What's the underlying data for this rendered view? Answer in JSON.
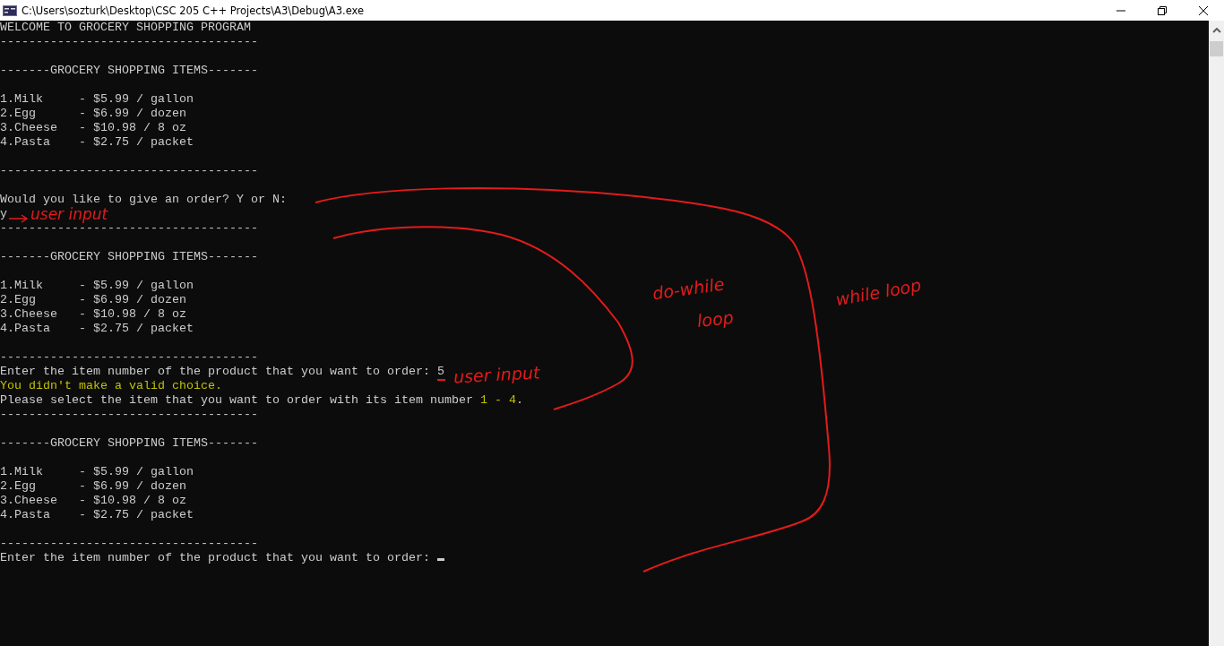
{
  "window": {
    "title": "C:\\Users\\sozturk\\Desktop\\CSC 205 C++ Projects\\A3\\Debug\\A3.exe"
  },
  "console": {
    "lines": [
      {
        "kind": "text",
        "segments": [
          {
            "text": "WELCOME TO GROCERY SHOPPING PROGRAM",
            "highlight": false
          }
        ]
      },
      {
        "kind": "text",
        "segments": [
          {
            "text": "------------------------------------",
            "highlight": false
          }
        ]
      },
      {
        "kind": "blank"
      },
      {
        "kind": "text",
        "segments": [
          {
            "text": "-------GROCERY SHOPPING ITEMS-------",
            "highlight": false
          }
        ]
      },
      {
        "kind": "blank"
      },
      {
        "kind": "text",
        "segments": [
          {
            "text": "1.Milk     - $5.99 / gallon",
            "highlight": false
          }
        ]
      },
      {
        "kind": "text",
        "segments": [
          {
            "text": "2.Egg      - $6.99 / dozen",
            "highlight": false
          }
        ]
      },
      {
        "kind": "text",
        "segments": [
          {
            "text": "3.Cheese   - $10.98 / 8 oz",
            "highlight": false
          }
        ]
      },
      {
        "kind": "text",
        "segments": [
          {
            "text": "4.Pasta    - $2.75 / packet",
            "highlight": false
          }
        ]
      },
      {
        "kind": "blank"
      },
      {
        "kind": "text",
        "segments": [
          {
            "text": "------------------------------------",
            "highlight": false
          }
        ]
      },
      {
        "kind": "blank"
      },
      {
        "kind": "text",
        "segments": [
          {
            "text": "Would you like to give an order? Y or N:",
            "highlight": false
          }
        ]
      },
      {
        "kind": "text",
        "segments": [
          {
            "text": "y",
            "highlight": false
          }
        ]
      },
      {
        "kind": "text",
        "segments": [
          {
            "text": "------------------------------------",
            "highlight": false
          }
        ]
      },
      {
        "kind": "blank"
      },
      {
        "kind": "text",
        "segments": [
          {
            "text": "-------GROCERY SHOPPING ITEMS-------",
            "highlight": false
          }
        ]
      },
      {
        "kind": "blank"
      },
      {
        "kind": "text",
        "segments": [
          {
            "text": "1.Milk     - $5.99 / gallon",
            "highlight": false
          }
        ]
      },
      {
        "kind": "text",
        "segments": [
          {
            "text": "2.Egg      - $6.99 / dozen",
            "highlight": false
          }
        ]
      },
      {
        "kind": "text",
        "segments": [
          {
            "text": "3.Cheese   - $10.98 / 8 oz",
            "highlight": false
          }
        ]
      },
      {
        "kind": "text",
        "segments": [
          {
            "text": "4.Pasta    - $2.75 / packet",
            "highlight": false
          }
        ]
      },
      {
        "kind": "blank"
      },
      {
        "kind": "text",
        "segments": [
          {
            "text": "------------------------------------",
            "highlight": false
          }
        ]
      },
      {
        "kind": "text",
        "segments": [
          {
            "text": "Enter the item number of the product that you want to order: 5",
            "highlight": false
          }
        ]
      },
      {
        "kind": "text",
        "segments": [
          {
            "text": "You didn't make a valid choice.",
            "highlight": true
          }
        ]
      },
      {
        "kind": "text",
        "segments": [
          {
            "text": "Please select the item that you want to order with its item number ",
            "highlight": false
          },
          {
            "text": "1 - 4",
            "highlight": true
          },
          {
            "text": ".",
            "highlight": false
          }
        ]
      },
      {
        "kind": "text",
        "segments": [
          {
            "text": "------------------------------------",
            "highlight": false
          }
        ]
      },
      {
        "kind": "blank"
      },
      {
        "kind": "text",
        "segments": [
          {
            "text": "-------GROCERY SHOPPING ITEMS-------",
            "highlight": false
          }
        ]
      },
      {
        "kind": "blank"
      },
      {
        "kind": "text",
        "segments": [
          {
            "text": "1.Milk     - $5.99 / gallon",
            "highlight": false
          }
        ]
      },
      {
        "kind": "text",
        "segments": [
          {
            "text": "2.Egg      - $6.99 / dozen",
            "highlight": false
          }
        ]
      },
      {
        "kind": "text",
        "segments": [
          {
            "text": "3.Cheese   - $10.98 / 8 oz",
            "highlight": false
          }
        ]
      },
      {
        "kind": "text",
        "segments": [
          {
            "text": "4.Pasta    - $2.75 / packet",
            "highlight": false
          }
        ]
      },
      {
        "kind": "blank"
      },
      {
        "kind": "text",
        "segments": [
          {
            "text": "------------------------------------",
            "highlight": false
          }
        ]
      },
      {
        "kind": "prompt",
        "segments": [
          {
            "text": "Enter the item number of the product that you want to order: ",
            "highlight": false
          }
        ]
      }
    ]
  },
  "annotations": [
    {
      "text": "user input"
    },
    {
      "text": "user input"
    },
    {
      "text": "do-while"
    },
    {
      "text": "loop"
    },
    {
      "text": "while loop"
    }
  ]
}
